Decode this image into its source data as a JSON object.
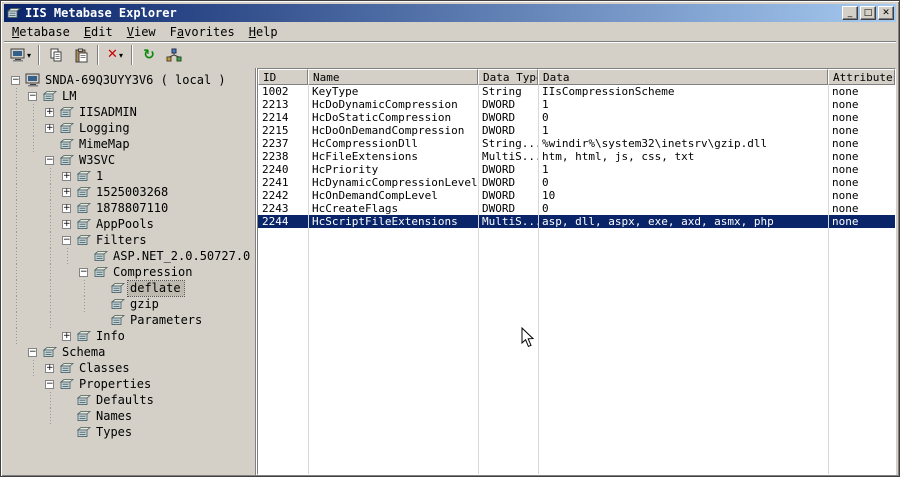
{
  "window": {
    "title": "IIS Metabase Explorer",
    "controls": {
      "minimize": "_",
      "maximize": "□",
      "close": "✕"
    }
  },
  "colors": {
    "titlebar_from": "#0a246a",
    "titlebar_to": "#a6caf0",
    "selection": "#0a246a",
    "chrome": "#d4d0c8"
  },
  "menu": {
    "items": [
      {
        "label": "Metabase",
        "accel": 0
      },
      {
        "label": "Edit",
        "accel": 0
      },
      {
        "label": "View",
        "accel": 0
      },
      {
        "label": "Favorites",
        "accel": 1
      },
      {
        "label": "Help",
        "accel": 0
      }
    ]
  },
  "toolbar": {
    "buttons": [
      {
        "name": "connect-button",
        "icon": "computer-icon",
        "dropdown": true
      },
      {
        "type": "separator"
      },
      {
        "name": "copy-button",
        "icon": "copy-icon"
      },
      {
        "name": "paste-button",
        "icon": "paste-icon"
      },
      {
        "type": "separator"
      },
      {
        "name": "delete-button",
        "icon": "delete-icon",
        "dropdown": true
      },
      {
        "type": "separator"
      },
      {
        "name": "refresh-button",
        "icon": "refresh-icon"
      },
      {
        "name": "network-button",
        "icon": "network-icon"
      }
    ]
  },
  "tree": {
    "items": [
      {
        "label": "SNDA-69Q3UYY3V6 ( local )",
        "depth": 0,
        "expander": "minus",
        "icon": "computer-icon",
        "selected": false
      },
      {
        "label": "LM",
        "depth": 1,
        "expander": "minus",
        "icon": "node-icon",
        "selected": false
      },
      {
        "label": "IISADMIN",
        "depth": 2,
        "expander": "plus",
        "icon": "node-icon",
        "selected": false
      },
      {
        "label": "Logging",
        "depth": 2,
        "expander": "plus",
        "icon": "node-icon",
        "selected": false
      },
      {
        "label": "MimeMap",
        "depth": 2,
        "expander": "none",
        "icon": "node-icon",
        "selected": false
      },
      {
        "label": "W3SVC",
        "depth": 2,
        "expander": "minus",
        "icon": "node-icon",
        "selected": false
      },
      {
        "label": "1",
        "depth": 3,
        "expander": "plus",
        "icon": "node-icon",
        "selected": false
      },
      {
        "label": "1525003268",
        "depth": 3,
        "expander": "plus",
        "icon": "node-icon",
        "selected": false
      },
      {
        "label": "1878807110",
        "depth": 3,
        "expander": "plus",
        "icon": "node-icon",
        "selected": false
      },
      {
        "label": "AppPools",
        "depth": 3,
        "expander": "plus",
        "icon": "node-icon",
        "selected": false
      },
      {
        "label": "Filters",
        "depth": 3,
        "expander": "minus",
        "icon": "node-icon",
        "selected": false
      },
      {
        "label": "ASP.NET_2.0.50727.0",
        "depth": 4,
        "expander": "none",
        "icon": "node-icon",
        "selected": false
      },
      {
        "label": "Compression",
        "depth": 4,
        "expander": "minus",
        "icon": "node-icon",
        "selected": false
      },
      {
        "label": "deflate",
        "depth": 5,
        "expander": "none",
        "icon": "node-icon",
        "selected": true
      },
      {
        "label": "gzip",
        "depth": 5,
        "expander": "none",
        "icon": "node-icon",
        "selected": false
      },
      {
        "label": "Parameters",
        "depth": 5,
        "expander": "none",
        "icon": "node-icon",
        "selected": false
      },
      {
        "label": "Info",
        "depth": 3,
        "expander": "plus",
        "icon": "node-icon",
        "selected": false
      },
      {
        "label": "Schema",
        "depth": 1,
        "expander": "minus",
        "icon": "node-icon",
        "selected": false
      },
      {
        "label": "Classes",
        "depth": 2,
        "expander": "plus",
        "icon": "node-icon",
        "selected": false
      },
      {
        "label": "Properties",
        "depth": 2,
        "expander": "minus",
        "icon": "node-icon",
        "selected": false
      },
      {
        "label": "Defaults",
        "depth": 3,
        "expander": "none",
        "icon": "node-icon",
        "selected": false
      },
      {
        "label": "Names",
        "depth": 3,
        "expander": "none",
        "icon": "node-icon",
        "selected": false
      },
      {
        "label": "Types",
        "depth": 3,
        "expander": "none",
        "icon": "node-icon",
        "selected": false
      }
    ]
  },
  "list": {
    "columns": [
      "ID",
      "Name",
      "Data Type",
      "Data",
      "Attributes"
    ],
    "rows": [
      {
        "cells": [
          "1002",
          "KeyType",
          "String",
          "IIsCompressionScheme",
          "none"
        ],
        "selected": false
      },
      {
        "cells": [
          "2213",
          "HcDoDynamicCompression",
          "DWORD",
          "1",
          "none"
        ],
        "selected": false
      },
      {
        "cells": [
          "2214",
          "HcDoStaticCompression",
          "DWORD",
          "0",
          "none"
        ],
        "selected": false
      },
      {
        "cells": [
          "2215",
          "HcDoOnDemandCompression",
          "DWORD",
          "1",
          "none"
        ],
        "selected": false
      },
      {
        "cells": [
          "2237",
          "HcCompressionDll",
          "String...",
          "%windir%\\system32\\inetsrv\\gzip.dll",
          "none"
        ],
        "selected": false
      },
      {
        "cells": [
          "2238",
          "HcFileExtensions",
          "MultiS...",
          "htm, html, js, css, txt",
          "none"
        ],
        "selected": false
      },
      {
        "cells": [
          "2240",
          "HcPriority",
          "DWORD",
          "1",
          "none"
        ],
        "selected": false
      },
      {
        "cells": [
          "2241",
          "HcDynamicCompressionLevel",
          "DWORD",
          "0",
          "none"
        ],
        "selected": false
      },
      {
        "cells": [
          "2242",
          "HcOnDemandCompLevel",
          "DWORD",
          "10",
          "none"
        ],
        "selected": false
      },
      {
        "cells": [
          "2243",
          "HcCreateFlags",
          "DWORD",
          "0",
          "none"
        ],
        "selected": false
      },
      {
        "cells": [
          "2244",
          "HcScriptFileExtensions",
          "MultiS...",
          "asp, dll, aspx, exe, axd, asmx, php",
          "none"
        ],
        "selected": true
      }
    ]
  }
}
